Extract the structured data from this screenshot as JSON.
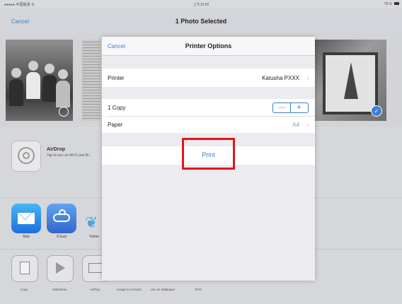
{
  "status_bar": {
    "carrier": "●●●●● 中国联通 令",
    "time": "上午10:06",
    "battery": "78 %"
  },
  "nav": {
    "cancel_label": "Cancel",
    "title": "1 Photo Selected"
  },
  "airdrop": {
    "title": "AirDrop",
    "subtitle": "Tap to turn on Wi-Fi and Bl..."
  },
  "share_apps": [
    {
      "label": "Mail",
      "icon": "mail-icon"
    },
    {
      "label": "iCloud",
      "icon": "icloud-icon"
    },
    {
      "label": "Twitter",
      "icon": "twitter-icon"
    }
  ],
  "actions": [
    {
      "label": "Copy",
      "icon": "copy-icon"
    },
    {
      "label": "Slideshow",
      "icon": "play-icon"
    },
    {
      "label": "AirPlay",
      "icon": "airplay-icon"
    },
    {
      "label": "Assign to Contact",
      "icon": "contact-icon"
    },
    {
      "label": "Use as Wallpaper",
      "icon": "wallpaper-icon"
    },
    {
      "label": "Print",
      "icon": "print-icon"
    }
  ],
  "printer_options": {
    "cancel_label": "Cancel",
    "title": "Printer Options",
    "printer_label": "Printer",
    "printer_value": "Katusha PXXX",
    "copies_label": "1 Copy",
    "stepper_minus": "—",
    "stepper_plus": "+",
    "paper_label": "Paper",
    "paper_value": "A4",
    "print_label": "Print"
  },
  "colors": {
    "accent": "#3b7bd4",
    "highlight": "#e0161c"
  }
}
